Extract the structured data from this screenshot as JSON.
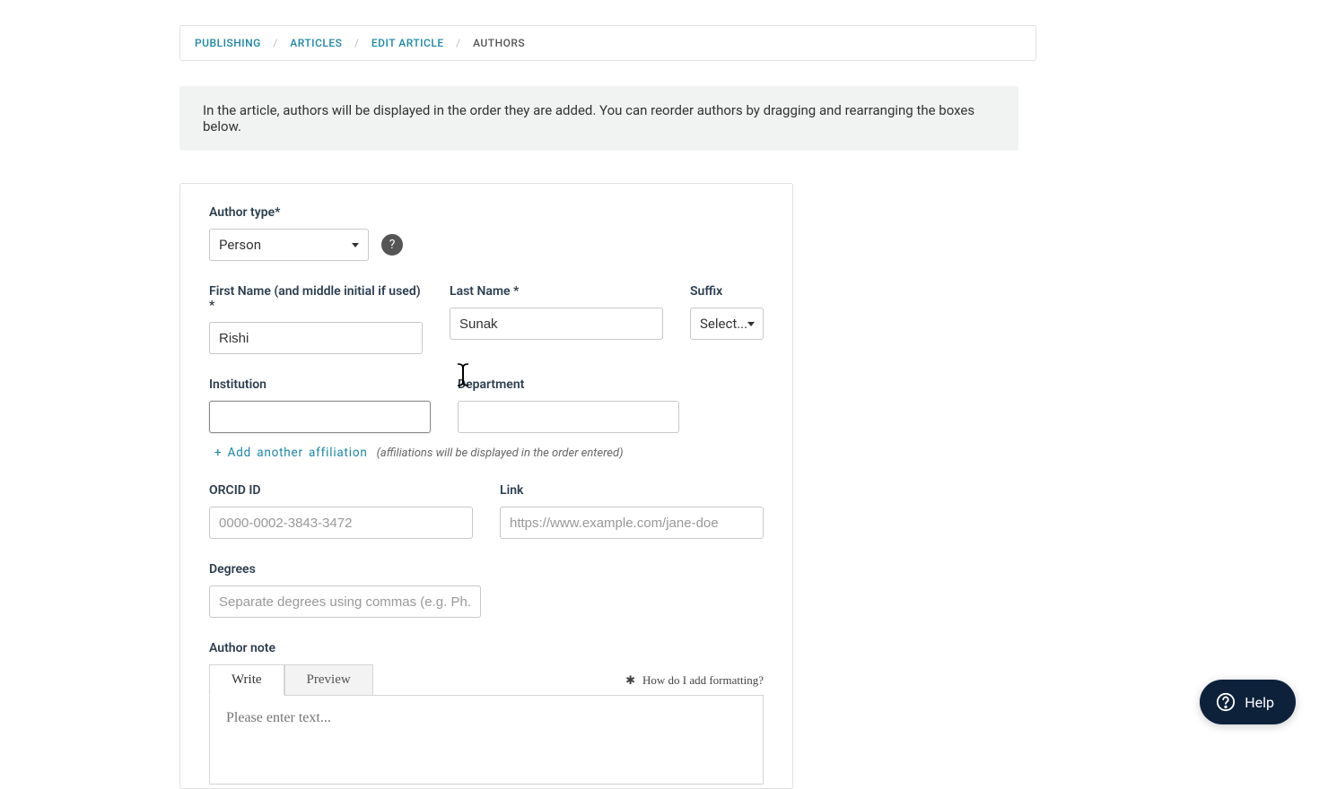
{
  "breadcrumbs": {
    "items": [
      "PUBLISHING",
      "ARTICLES",
      "EDIT ARTICLE"
    ],
    "current": "AUTHORS"
  },
  "banner": {
    "text": "In the article, authors will be displayed in the order they are added. You can reorder authors by dragging and rearranging the boxes below."
  },
  "form": {
    "author_type": {
      "label": "Author type*",
      "value": "Person",
      "help": "?"
    },
    "first_name": {
      "label": "First Name (and middle initial if used) *",
      "value": "Rishi"
    },
    "last_name": {
      "label": "Last Name *",
      "value": "Sunak"
    },
    "suffix": {
      "label": "Suffix",
      "value": "Select..."
    },
    "institution": {
      "label": "Institution",
      "value": ""
    },
    "department": {
      "label": "Department",
      "value": ""
    },
    "add_affiliation": {
      "link": "+ Add another affiliation",
      "note": "(affiliations will be displayed in the order entered)"
    },
    "orcid": {
      "label": "ORCID ID",
      "placeholder": "0000-0002-3843-3472",
      "value": ""
    },
    "link": {
      "label": "Link",
      "placeholder": "https://www.example.com/jane-doe",
      "value": ""
    },
    "degrees": {
      "label": "Degrees",
      "placeholder": "Separate degrees using commas (e.g. Ph.D., M.D",
      "value": ""
    },
    "author_note": {
      "label": "Author note",
      "tabs": {
        "write": "Write",
        "preview": "Preview"
      },
      "help": "How do I add formatting?",
      "placeholder": "Please enter text..."
    }
  },
  "help_widget": {
    "label": "Help"
  }
}
